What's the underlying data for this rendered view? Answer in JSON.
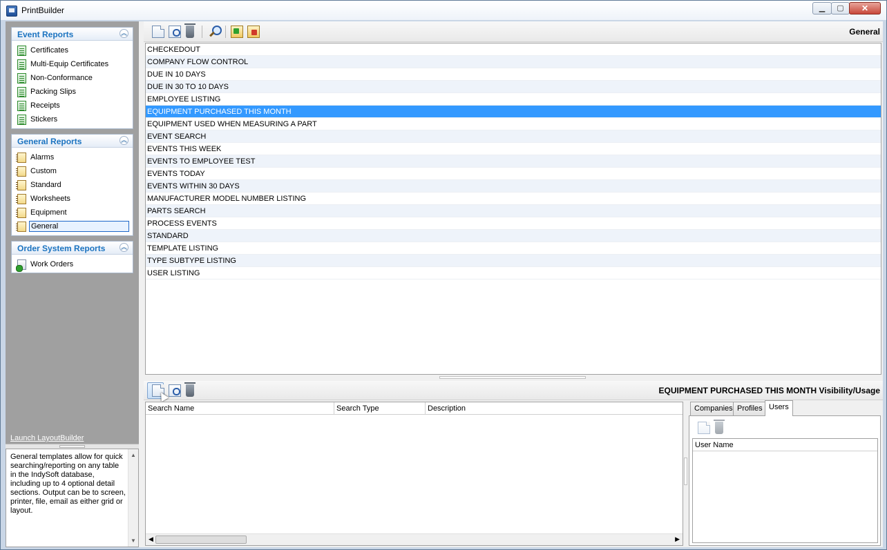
{
  "window": {
    "title": "PrintBuilder"
  },
  "nav": {
    "groups": [
      {
        "title": "Event Reports",
        "items": [
          "Certificates",
          "Multi-Equip Certificates",
          "Non-Conformance",
          "Packing Slips",
          "Receipts",
          "Stickers"
        ]
      },
      {
        "title": "General Reports",
        "items": [
          "Alarms",
          "Custom",
          "Standard",
          "Worksheets",
          "Equipment",
          "General"
        ],
        "selected": "General"
      },
      {
        "title": "Order System Reports",
        "items": [
          "Work Orders"
        ]
      }
    ],
    "launch_link": "Launch LayoutBuilder",
    "description": "General templates allow for quick searching/reporting on any table in the IndySoft database, including up to 4 optional detail sections.  Output can be to screen, printer, file, email as either grid or layout."
  },
  "top_panel": {
    "title": "General",
    "reports": [
      "CHECKEDOUT",
      "COMPANY FLOW CONTROL",
      "DUE IN 10 DAYS",
      "DUE IN 30 TO 10 DAYS",
      "EMPLOYEE LISTING",
      "EQUIPMENT PURCHASED THIS MONTH",
      "EQUIPMENT USED WHEN MEASURING A PART",
      "EVENT SEARCH",
      "EVENTS THIS WEEK",
      "EVENTS TO EMPLOYEE TEST",
      "EVENTS TODAY",
      "EVENTS WITHIN 30 DAYS",
      "MANUFACTURER MODEL NUMBER LISTING",
      "PARTS SEARCH",
      "PROCESS EVENTS",
      "STANDARD",
      "TEMPLATE LISTING",
      "TYPE SUBTYPE LISTING",
      "USER LISTING"
    ],
    "selected_index": 5
  },
  "bottom_panel": {
    "title": "EQUIPMENT PURCHASED THIS MONTH Visibility/Usage",
    "columns": [
      "Search Name",
      "Search Type",
      "Description"
    ],
    "tabs": [
      "Companies",
      "Profiles",
      "Users"
    ],
    "active_tab": "Users",
    "users_column": "User Name"
  },
  "colors": {
    "selection": "#3399ff",
    "nav_header_text": "#1b73c0",
    "nav_background": "#a0a0a0"
  },
  "icons": [
    "new-icon",
    "preview-icon",
    "delete-icon",
    "search-icon",
    "import-icon",
    "export-icon",
    "certificate-icon",
    "notebook-icon",
    "work-order-icon"
  ]
}
